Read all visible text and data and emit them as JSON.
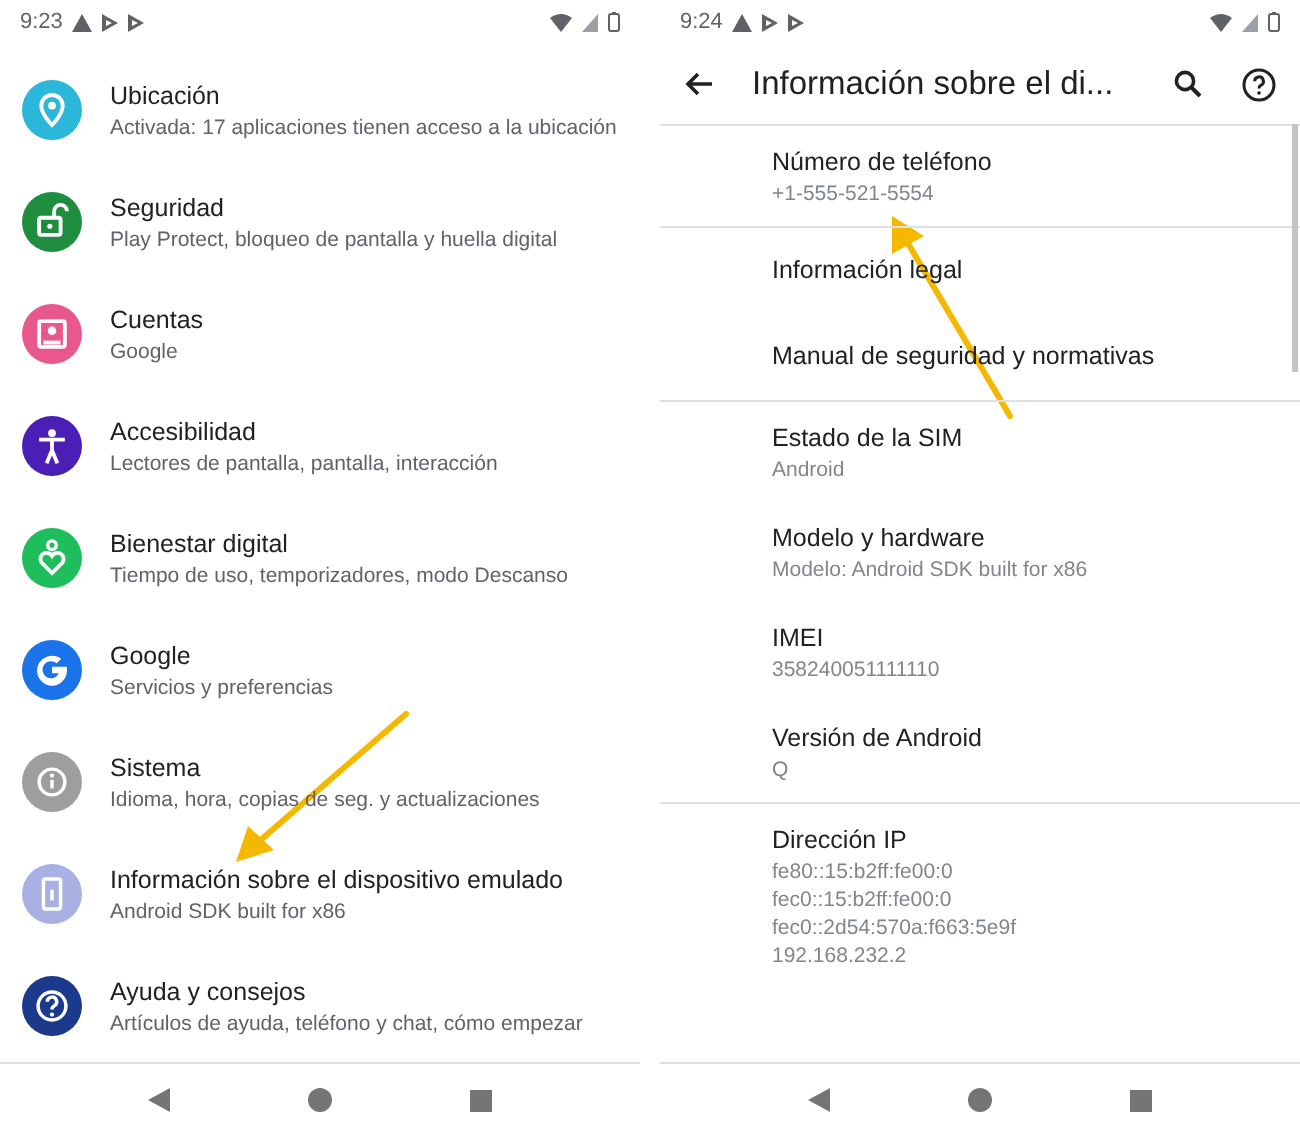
{
  "settings_screen": {
    "status_bar": {
      "time": "9:23"
    },
    "items": [
      {
        "kind": "location",
        "title": "Ubicación",
        "subtitle": "Activada: 17 aplicaciones tienen acceso a la ubicación",
        "color": "#2bb7d9"
      },
      {
        "kind": "lock",
        "title": "Seguridad",
        "subtitle": "Play Protect, bloqueo de pantalla y huella digital",
        "color": "#1e8e3e"
      },
      {
        "kind": "account",
        "title": "Cuentas",
        "subtitle": "Google",
        "color": "#e8588c"
      },
      {
        "kind": "accessibility",
        "title": "Accesibilidad",
        "subtitle": "Lectores de pantalla, pantalla, interacción",
        "color": "#4b1fb5"
      },
      {
        "kind": "wellbeing",
        "title": "Bienestar digital",
        "subtitle": "Tiempo de uso, temporizadores, modo Descanso",
        "color": "#1fbe5c"
      },
      {
        "kind": "google",
        "title": "Google",
        "subtitle": "Servicios y preferencias",
        "color": "#1a73e8"
      },
      {
        "kind": "info",
        "title": "Sistema",
        "subtitle": "Idioma, hora, copias de seg. y actualizaciones",
        "color": "#9e9e9e"
      },
      {
        "kind": "device",
        "title": "Información sobre el dispositivo emulado",
        "subtitle": "Android SDK built for x86",
        "color": "#a9b1e2"
      },
      {
        "kind": "help",
        "title": "Ayuda y consejos",
        "subtitle": "Artículos de ayuda, teléfono y chat, cómo empezar",
        "color": "#1c3a8c"
      }
    ]
  },
  "device_info_screen": {
    "status_bar": {
      "time": "9:24"
    },
    "toolbar": {
      "title": "Información sobre el di..."
    },
    "groups": [
      [
        {
          "title": "Número de teléfono",
          "lines": [
            "+1-555-521-5554"
          ]
        }
      ],
      [
        {
          "title": "Información legal"
        },
        {
          "title": "Manual de seguridad y normativas"
        }
      ],
      [
        {
          "title": "Estado de la SIM",
          "lines": [
            "Android"
          ]
        },
        {
          "title": "Modelo y hardware",
          "lines": [
            "Modelo: Android SDK built for x86"
          ]
        },
        {
          "title": "IMEI",
          "lines": [
            "358240051111110"
          ]
        },
        {
          "title": "Versión de Android",
          "lines": [
            "Q"
          ]
        }
      ],
      [
        {
          "title": "Dirección IP",
          "lines": [
            "fe80::15:b2ff:fe00:0",
            "fec0::15:b2ff:fe00:0",
            "fec0::2d54:570a:f663:5e9f",
            "192.168.232.2"
          ]
        }
      ]
    ]
  }
}
